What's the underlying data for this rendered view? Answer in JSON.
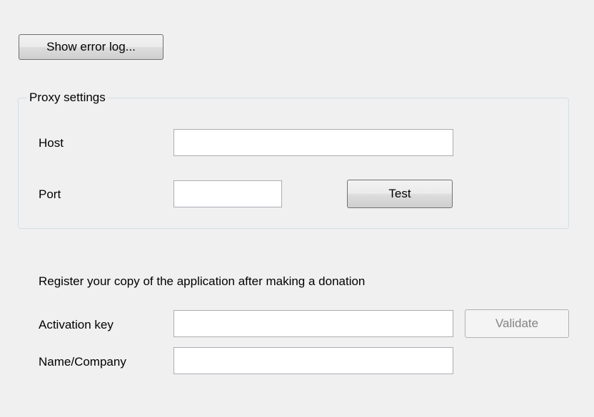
{
  "toolbar": {
    "show_error_log_label": "Show error log..."
  },
  "proxy": {
    "group_title": "Proxy settings",
    "host_label": "Host",
    "host_value": "",
    "port_label": "Port",
    "port_value": "",
    "test_label": "Test"
  },
  "registration": {
    "info_text": "Register your copy of the application after making a donation",
    "activation_key_label": "Activation key",
    "activation_key_value": "",
    "validate_label": "Validate",
    "validate_enabled": false,
    "name_company_label": "Name/Company",
    "name_company_value": ""
  }
}
